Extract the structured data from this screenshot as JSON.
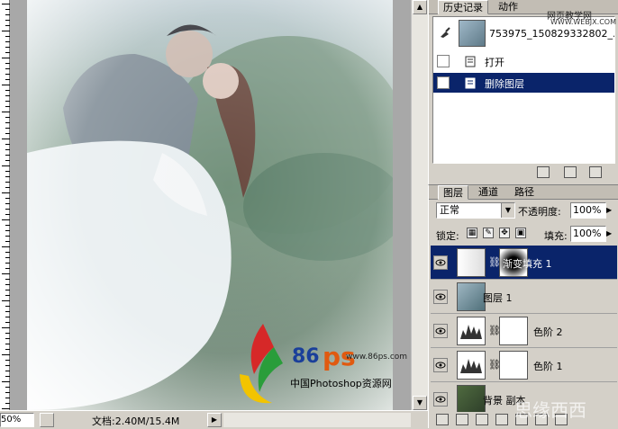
{
  "canvas": {
    "zoom": "50%",
    "doc_info": "文档:2.40M/15.4M"
  },
  "history_panel": {
    "tabs": [
      {
        "label": "历史记录",
        "active": true
      },
      {
        "label": "动作",
        "active": false
      }
    ],
    "snapshot": {
      "label": "753975_15082...",
      "label_full": "753975_150829332802_..."
    },
    "items": [
      {
        "label": "打开",
        "selected": false
      },
      {
        "label": "删除图层",
        "selected": true
      }
    ]
  },
  "watermark": {
    "site": "网页教学网",
    "url": "WWW.WEBJX.COM",
    "bottom": "思缘西西"
  },
  "layers_panel": {
    "tabs": [
      {
        "label": "图层",
        "active": true
      },
      {
        "label": "通道",
        "active": false
      },
      {
        "label": "路径",
        "active": false
      }
    ],
    "blend_mode": "正常",
    "opacity_label": "不透明度:",
    "opacity_value": "100%",
    "lock_label": "锁定:",
    "fill_label": "填充:",
    "fill_value": "100%",
    "layers": [
      {
        "name": "渐变填充 1",
        "selected": true,
        "type": "gradient-fill"
      },
      {
        "name": "图层 1",
        "selected": false,
        "type": "pixel"
      },
      {
        "name": "色阶 2",
        "selected": false,
        "type": "levels"
      },
      {
        "name": "色阶 1",
        "selected": false,
        "type": "levels"
      },
      {
        "name": "背景 副本",
        "selected": false,
        "type": "pixel"
      }
    ]
  },
  "logo": {
    "brand_number": "86",
    "brand_letters": "ps",
    "url": "www.86ps.com",
    "caption": "中国Photoshop资源网"
  },
  "colors": {
    "selection": "#0a246a",
    "panel": "#d4d0c8",
    "logo_blue": "#1a3f9a",
    "logo_orange": "#e05a10"
  }
}
